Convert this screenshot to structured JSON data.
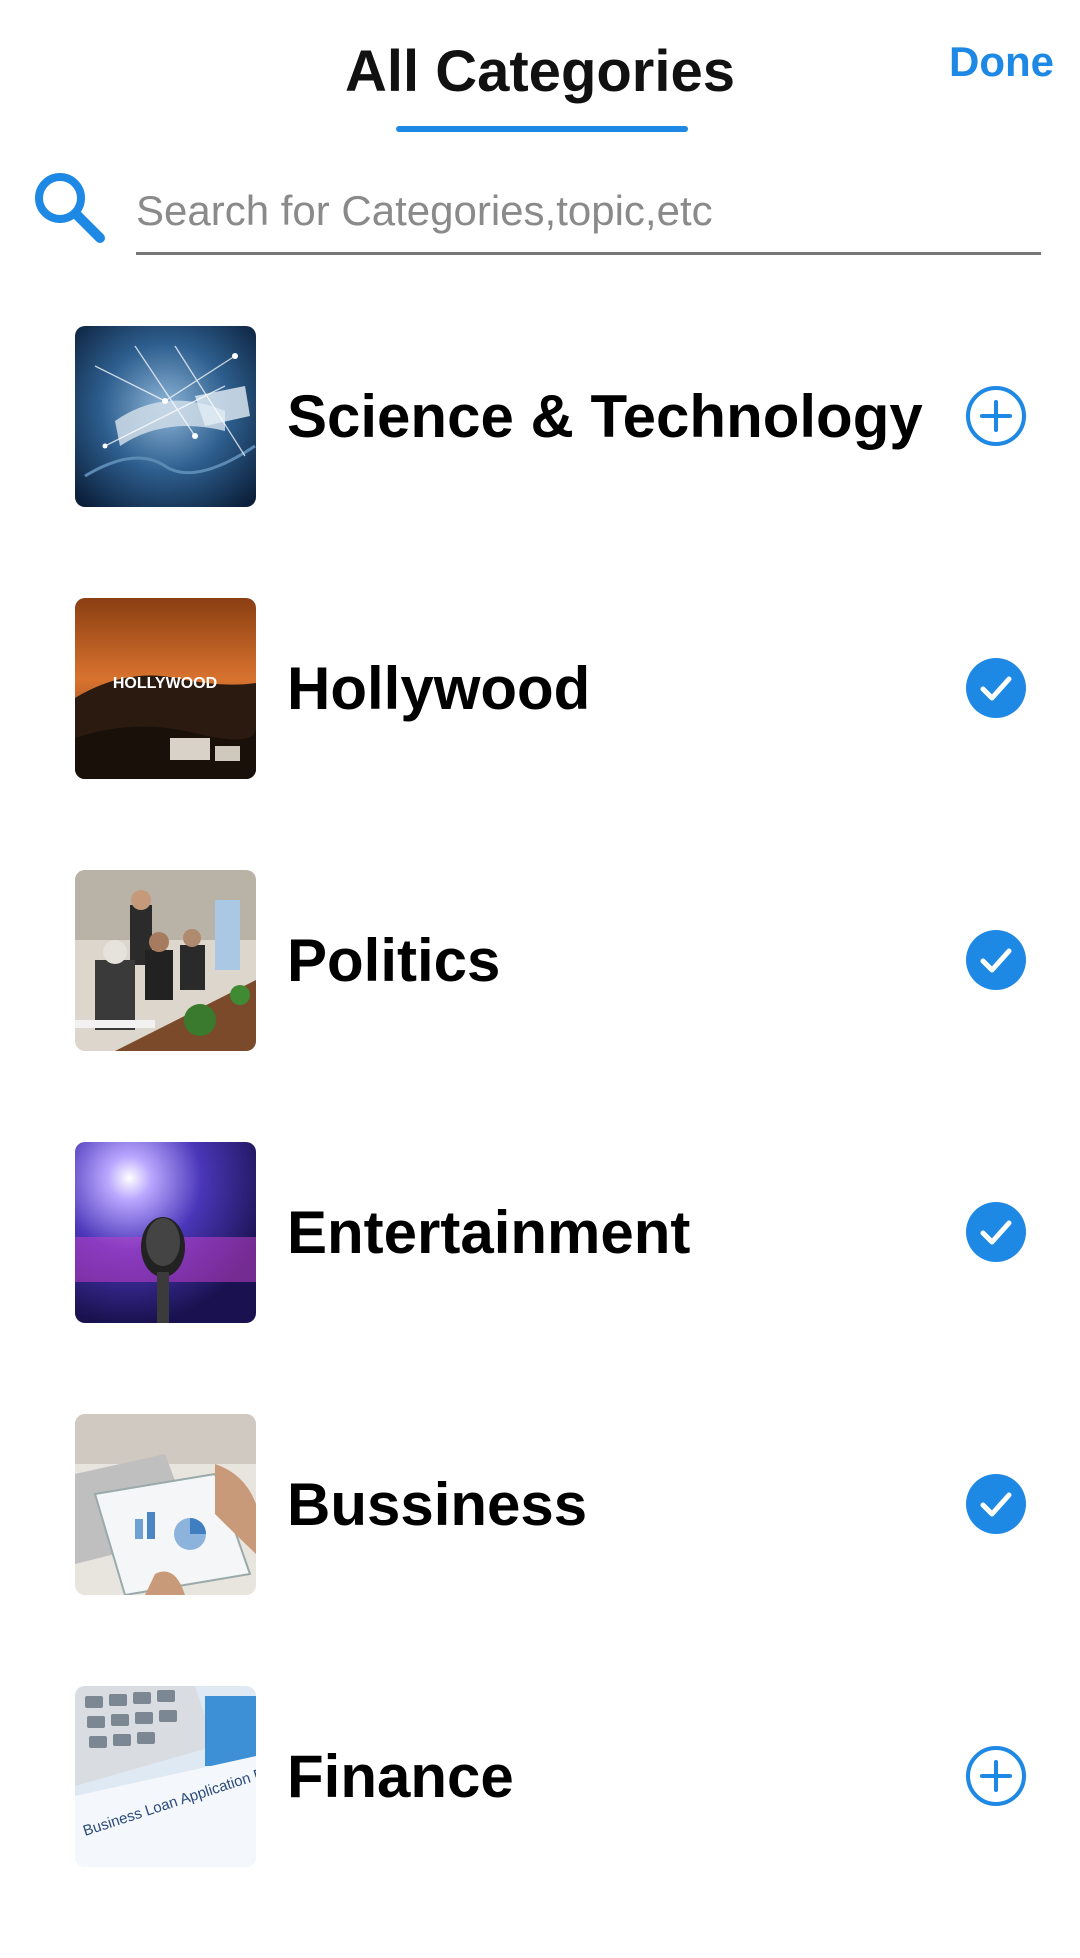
{
  "header": {
    "title": "All Categories",
    "done_label": "Done"
  },
  "search": {
    "placeholder": "Search for Categories,topic,etc",
    "value": ""
  },
  "colors": {
    "accent": "#1e88e5"
  },
  "categories": [
    {
      "label": "Science & Technology",
      "state": "add",
      "icon": "plus-circle-icon"
    },
    {
      "label": "Hollywood",
      "state": "selected",
      "icon": "check-circle-icon",
      "thumb_text": "HOLLYWOOD"
    },
    {
      "label": "Politics",
      "state": "selected",
      "icon": "check-circle-icon"
    },
    {
      "label": "Entertainment",
      "state": "selected",
      "icon": "check-circle-icon"
    },
    {
      "label": "Bussiness",
      "state": "selected",
      "icon": "check-circle-icon"
    },
    {
      "label": "Finance",
      "state": "add",
      "icon": "plus-circle-icon",
      "thumb_text": "Business Loan Application Form"
    }
  ]
}
